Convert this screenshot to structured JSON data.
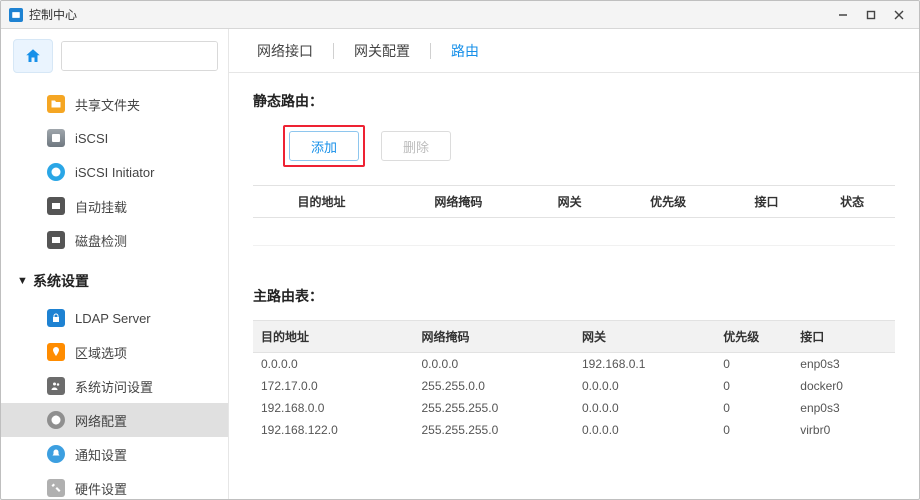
{
  "window": {
    "title": "控制中心"
  },
  "search": {
    "placeholder": ""
  },
  "sidebar": {
    "items_top": [
      {
        "label": "共享文件夹",
        "icon": "folder-icon",
        "color": "chip-orange"
      },
      {
        "label": "iSCSI",
        "icon": "disk-icon",
        "color": "chip-gray1"
      },
      {
        "label": "iSCSI Initiator",
        "icon": "globe-icon",
        "color": "chip-blue"
      },
      {
        "label": "自动挂载",
        "icon": "mount-icon",
        "color": "chip-black"
      },
      {
        "label": "磁盘检测",
        "icon": "scan-icon",
        "color": "chip-black2"
      }
    ],
    "section_label": "系统设置",
    "items_bottom": [
      {
        "label": "LDAP Server",
        "icon": "lock-icon",
        "color": "chip-blue2"
      },
      {
        "label": "区域选项",
        "icon": "pin-icon",
        "color": "chip-orange2"
      },
      {
        "label": "系统访问设置",
        "icon": "users-icon",
        "color": "chip-dark"
      },
      {
        "label": "网络配置",
        "icon": "network-icon",
        "color": "chip-gray2",
        "active": true
      },
      {
        "label": "通知设置",
        "icon": "bell-icon",
        "color": "chip-bluebell"
      },
      {
        "label": "硬件设置",
        "icon": "tools-icon",
        "color": "chip-tools"
      }
    ]
  },
  "tabs": [
    {
      "label": "网络接口"
    },
    {
      "label": "网关配置"
    },
    {
      "label": "路由",
      "active": true
    }
  ],
  "static_route": {
    "label": "静态路由：",
    "buttons": {
      "add": "添加",
      "delete": "删除"
    },
    "columns": [
      "目的地址",
      "网络掩码",
      "网关",
      "优先级",
      "接口",
      "状态"
    ]
  },
  "route_table": {
    "label": "主路由表：",
    "columns": [
      "目的地址",
      "网络掩码",
      "网关",
      "优先级",
      "接口"
    ],
    "rows": [
      {
        "dest": "0.0.0.0",
        "mask": "0.0.0.0",
        "gateway": "192.168.0.1",
        "prio": "0",
        "iface": "enp0s3"
      },
      {
        "dest": "172.17.0.0",
        "mask": "255.255.0.0",
        "gateway": "0.0.0.0",
        "prio": "0",
        "iface": "docker0"
      },
      {
        "dest": "192.168.0.0",
        "mask": "255.255.255.0",
        "gateway": "0.0.0.0",
        "prio": "0",
        "iface": "enp0s3"
      },
      {
        "dest": "192.168.122.0",
        "mask": "255.255.255.0",
        "gateway": "0.0.0.0",
        "prio": "0",
        "iface": "virbr0"
      }
    ]
  }
}
